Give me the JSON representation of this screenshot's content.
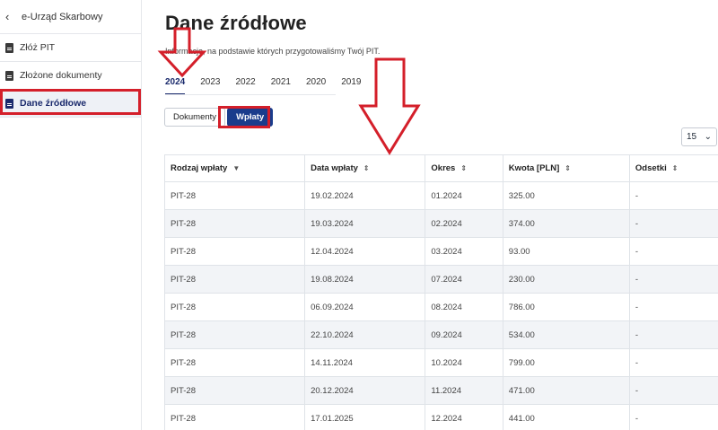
{
  "sidebar": {
    "app_title": "e-Urząd Skarbowy",
    "items": [
      {
        "label": "Złóż PIT"
      },
      {
        "label": "Złożone dokumenty"
      },
      {
        "label": "Dane źródłowe"
      }
    ]
  },
  "main": {
    "title": "Dane źródłowe",
    "subtitle": "Informacje, na podstawie których przygotowaliśmy Twój PIT.",
    "years": [
      "2024",
      "2023",
      "2022",
      "2021",
      "2020",
      "2019"
    ],
    "toggle": {
      "documents": "Dokumenty",
      "payments": "Wpłaty"
    },
    "page_size": "15",
    "table": {
      "headers": [
        "Rodzaj wpłaty",
        "Data wpłaty",
        "Okres",
        "Kwota [PLN]",
        "Odsetki"
      ],
      "rows": [
        [
          "PIT-28",
          "19.02.2024",
          "01.2024",
          "325.00",
          "-"
        ],
        [
          "PIT-28",
          "19.03.2024",
          "02.2024",
          "374.00",
          "-"
        ],
        [
          "PIT-28",
          "12.04.2024",
          "03.2024",
          "93.00",
          "-"
        ],
        [
          "PIT-28",
          "19.08.2024",
          "07.2024",
          "230.00",
          "-"
        ],
        [
          "PIT-28",
          "06.09.2024",
          "08.2024",
          "786.00",
          "-"
        ],
        [
          "PIT-28",
          "22.10.2024",
          "09.2024",
          "534.00",
          "-"
        ],
        [
          "PIT-28",
          "14.11.2024",
          "10.2024",
          "799.00",
          "-"
        ],
        [
          "PIT-28",
          "20.12.2024",
          "11.2024",
          "471.00",
          "-"
        ],
        [
          "PIT-28",
          "17.01.2025",
          "12.2024",
          "441.00",
          "-"
        ]
      ]
    }
  },
  "colors": {
    "accent": "#1a3c8c",
    "annotation": "#d41f2a"
  }
}
